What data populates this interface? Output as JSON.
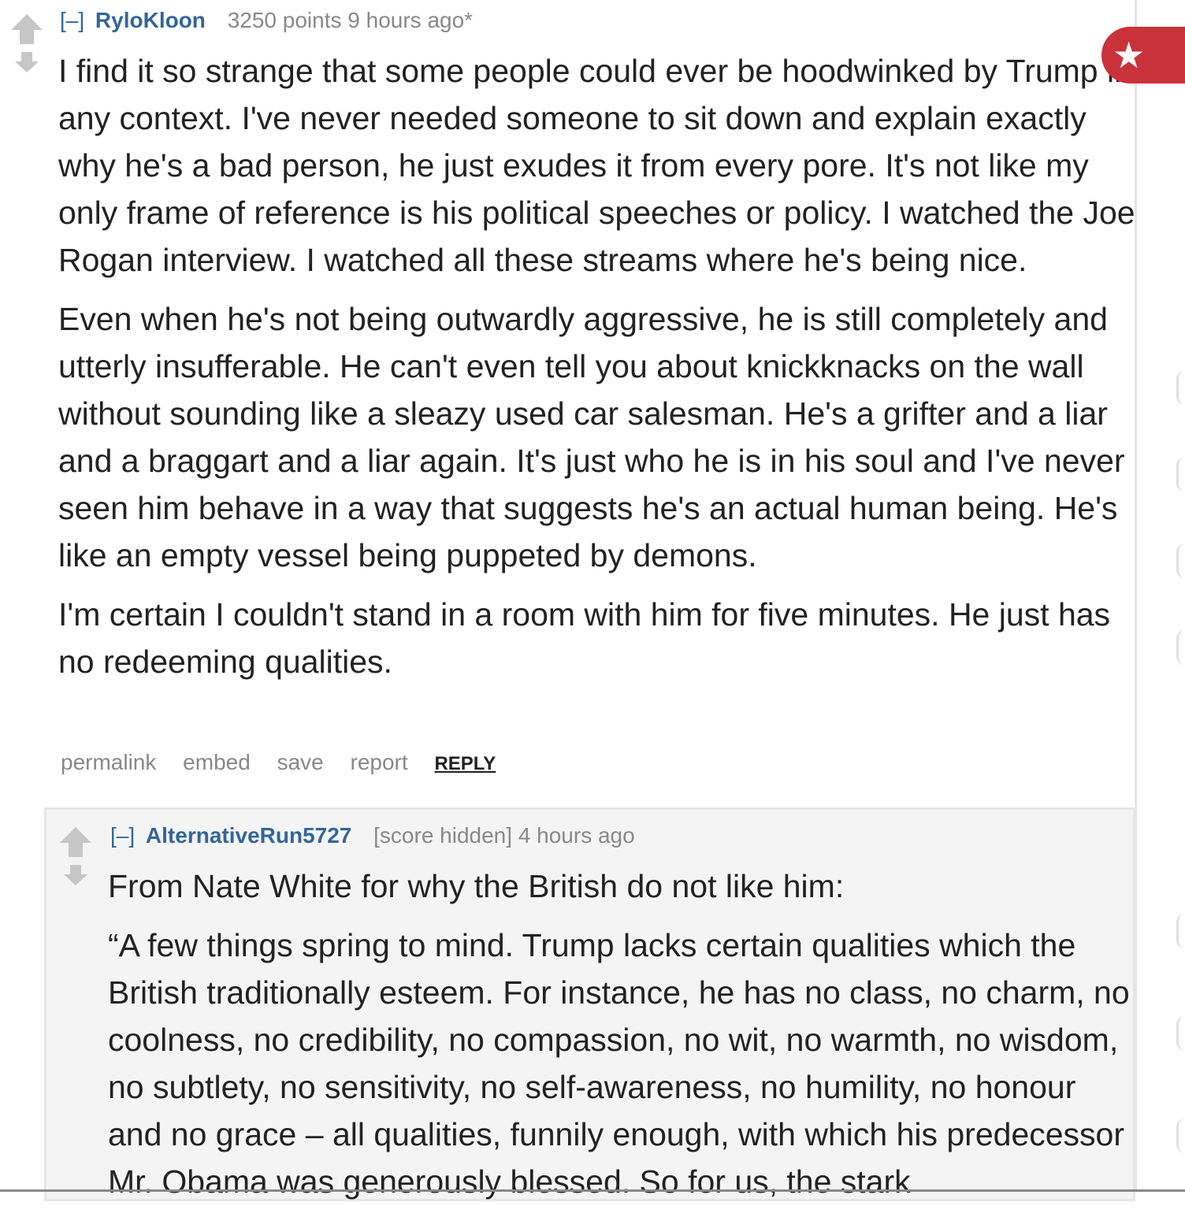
{
  "gild_icon": "star-icon",
  "accent_color": "#c9323a",
  "link_color": "#336699",
  "comments": [
    {
      "collapse": "[–]",
      "author": "RyloKloon",
      "score": "3250 points",
      "time": "9 hours ago*",
      "paragraphs": [
        "I find it so strange that some people could ever be hoodwinked by Trump in any context. I've never needed someone to sit down and explain exactly why he's a bad person, he just exudes it from every pore. It's not like my only frame of reference is his political speeches or policy. I watched the Joe Rogan interview. I watched all these streams where he's being nice.",
        "Even when he's not being outwardly aggressive, he is still completely and utterly insufferable. He can't even tell you about knickknacks on the wall without sounding like a sleazy used car salesman. He's a grifter and a liar and a braggart and a liar again. It's just who he is in his soul and I've never seen him behave in a way that suggests he's an actual human being. He's like an empty vessel being puppeted by demons.",
        "I'm certain I couldn't stand in a room with him for five minutes. He just has no redeeming qualities."
      ],
      "buttons": {
        "permalink": "permalink",
        "embed": "embed",
        "save": "save",
        "report": "report",
        "reply": "REPLY"
      }
    },
    {
      "collapse": "[–]",
      "author": "AlternativeRun5727",
      "score": "[score hidden]",
      "time": "4 hours ago",
      "paragraphs": [
        "From Nate White for why the British do not like him:",
        "“A few things spring to mind. Trump lacks certain qualities which the British traditionally esteem. For instance, he has no class, no charm, no coolness, no credibility, no compassion, no wit, no warmth, no wisdom, no subtlety, no sensitivity, no self-awareness, no humility, no honour and no grace – all qualities, funnily enough, with which his predecessor Mr. Obama was generously blessed. So for us, the stark"
      ]
    }
  ]
}
